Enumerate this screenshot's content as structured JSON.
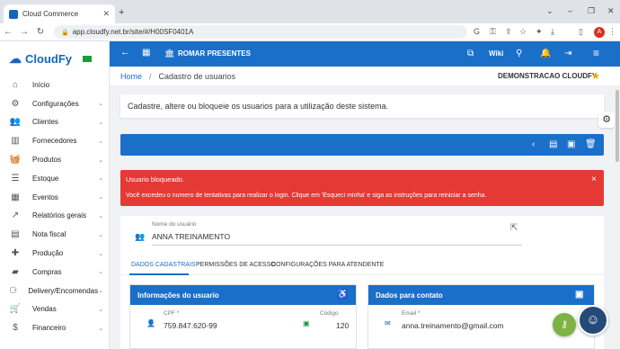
{
  "browser": {
    "tab_title": "Cloud Commerce",
    "url": "app.cloudfy.net.br/site/#/H00SF0401A",
    "avatar_letter": "A",
    "icons": [
      "google-icon",
      "key-icon",
      "share-icon",
      "bookmark-star-icon",
      "extensions-icon",
      "download-icon",
      "sidepanel-icon"
    ]
  },
  "sidebar": {
    "logo_text": "CloudFy",
    "items": [
      {
        "label": "Início",
        "icon": "home-icon",
        "has_children": false
      },
      {
        "label": "Configurações",
        "icon": "settings-icon",
        "has_children": true
      },
      {
        "label": "Clientes",
        "icon": "people-icon",
        "has_children": true
      },
      {
        "label": "Fornecedores",
        "icon": "building-icon",
        "has_children": true
      },
      {
        "label": "Produtos",
        "icon": "basket-icon",
        "has_children": true
      },
      {
        "label": "Estoque",
        "icon": "stock-list-icon",
        "has_children": true
      },
      {
        "label": "Eventos",
        "icon": "calendar-icon",
        "has_children": true
      },
      {
        "label": "Relatórios gerais",
        "icon": "chart-icon",
        "has_children": true
      },
      {
        "label": "Nota fiscal",
        "icon": "invoice-icon",
        "has_children": true
      },
      {
        "label": "Produção",
        "icon": "puzzle-icon",
        "has_children": true
      },
      {
        "label": "Compras",
        "icon": "briefcase-icon",
        "has_children": true
      },
      {
        "label": "Delivery/Encomendas",
        "icon": "motorbike-icon",
        "has_children": true
      },
      {
        "label": "Vendas",
        "icon": "cart-icon",
        "has_children": true
      },
      {
        "label": "Financeiro",
        "icon": "dollar-icon",
        "has_children": true
      }
    ]
  },
  "header": {
    "company": "ROMAR PRESENTES",
    "wiki_label": "Wiki"
  },
  "breadcrumb": {
    "home": "Home",
    "separator": "/",
    "page": "Cadastro de usuarios",
    "company": "DEMONSTRACAO CLOUDFY"
  },
  "description": "Cadastre, altere ou bloqueie os usuarios para a utilização deste sistema.",
  "alert": {
    "title": "Usuario bloqueado.",
    "message": "Você excedeu o numero de tentativas para realizar o login. Clique em 'Esqueci minha' e siga as instruções para reiniciar a senha.",
    "close": "×"
  },
  "form": {
    "username_caption": "Nome do usuário",
    "username_value": "ANNA TREINAMENTO",
    "tabs": [
      "DADOS CADASTRAIS",
      "PERMISSÕES DE ACESSO",
      "CONFIGURAÇÕES PARA ATENDENTE"
    ],
    "active_tab": 0,
    "info_panel": {
      "title": "Informações do usuario",
      "cpf_caption": "CPF *",
      "cpf_value": "759.847.620-99",
      "code_caption": "Código",
      "code_value": "120"
    },
    "contact_panel": {
      "title": "Dados para contato",
      "email_caption": "Email *",
      "email_value": "anna.treinamento@gmail.com"
    }
  },
  "colors": {
    "primary": "#1a6fc9",
    "alert": "#e53935",
    "star": "#f4a700",
    "key_fab": "#7cb342",
    "support_fab": "#264a77"
  }
}
